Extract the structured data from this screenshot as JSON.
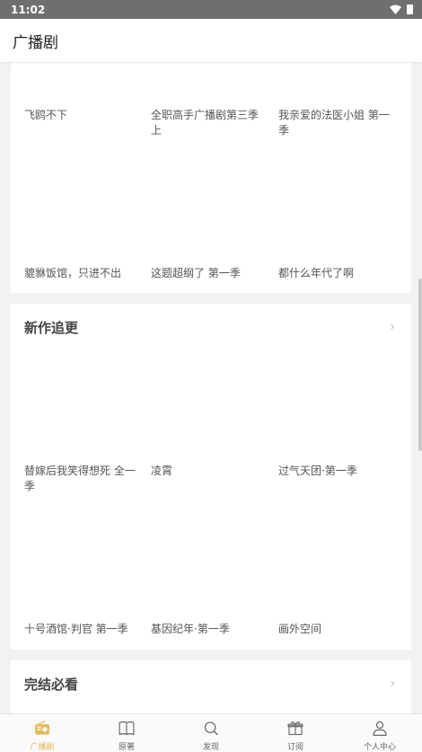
{
  "status_bar": {
    "time": "11:02"
  },
  "app_bar": {
    "title": "广播剧"
  },
  "sections": [
    {
      "items": [
        "飞鸥不下",
        "全职高手广播剧第三季 上",
        "我亲爱的法医小姐 第一季",
        "貔貅饭馆，只进不出",
        "这题超纲了 第一季",
        "都什么年代了啊"
      ]
    },
    {
      "title": "新作追更",
      "items": [
        "替嫁后我笑得想死 全一季",
        "凌霄",
        "过气天团·第一季",
        "十号酒馆·判官 第一季",
        "基因纪年·第一季",
        "画外空间"
      ]
    },
    {
      "title": "完结必看",
      "items": []
    }
  ],
  "bottom_nav": [
    {
      "label": "广播剧",
      "icon": "radio-icon",
      "active": true
    },
    {
      "label": "原著",
      "icon": "book-icon",
      "active": false
    },
    {
      "label": "发现",
      "icon": "search-icon",
      "active": false
    },
    {
      "label": "订阅",
      "icon": "gift-icon",
      "active": false
    },
    {
      "label": "个人中心",
      "icon": "user-icon",
      "active": false
    }
  ],
  "colors": {
    "accent": "#e4b85c",
    "status_bar": "#6f6f6f",
    "background": "#f2f2f2"
  }
}
